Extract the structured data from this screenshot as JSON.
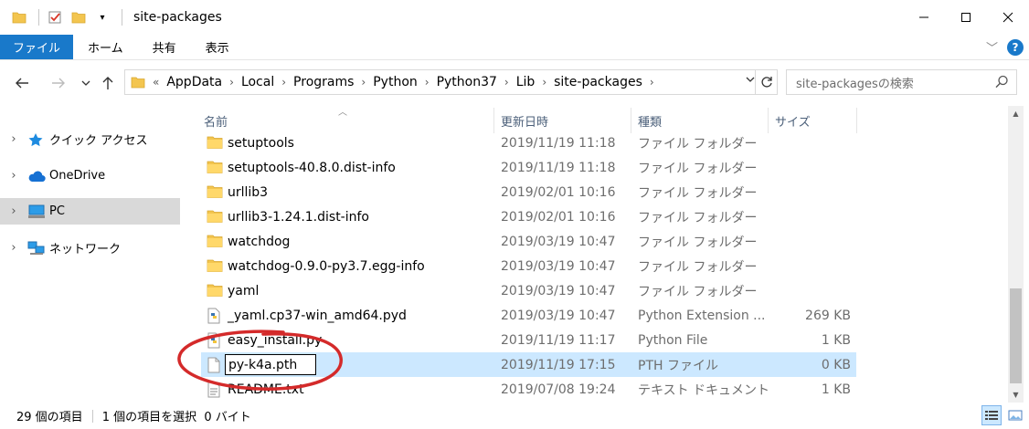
{
  "window": {
    "title": "site-packages"
  },
  "ribbon": {
    "tabs": [
      "ファイル",
      "ホーム",
      "共有",
      "表示"
    ]
  },
  "address": {
    "overflow": "«",
    "crumbs": [
      "AppData",
      "Local",
      "Programs",
      "Python",
      "Python37",
      "Lib",
      "site-packages"
    ],
    "search_placeholder": "site-packagesの検索"
  },
  "navpane": {
    "items": [
      {
        "label": "クイック アクセス",
        "icon": "star-icon",
        "selected": false
      },
      {
        "label": "OneDrive",
        "icon": "cloud-icon",
        "selected": false
      },
      {
        "label": "PC",
        "icon": "computer-icon",
        "selected": true
      },
      {
        "label": "ネットワーク",
        "icon": "network-icon",
        "selected": false
      }
    ]
  },
  "columns": {
    "name": "名前",
    "date": "更新日時",
    "type": "種類",
    "size": "サイズ"
  },
  "files": [
    {
      "name": "setuptools",
      "date": "2019/11/19 11:18",
      "type": "ファイル フォルダー",
      "size": "",
      "icon": "folder-icon"
    },
    {
      "name": "setuptools-40.8.0.dist-info",
      "date": "2019/11/19 11:18",
      "type": "ファイル フォルダー",
      "size": "",
      "icon": "folder-icon"
    },
    {
      "name": "urllib3",
      "date": "2019/02/01 10:16",
      "type": "ファイル フォルダー",
      "size": "",
      "icon": "folder-icon"
    },
    {
      "name": "urllib3-1.24.1.dist-info",
      "date": "2019/02/01 10:16",
      "type": "ファイル フォルダー",
      "size": "",
      "icon": "folder-icon"
    },
    {
      "name": "watchdog",
      "date": "2019/03/19 10:47",
      "type": "ファイル フォルダー",
      "size": "",
      "icon": "folder-icon"
    },
    {
      "name": "watchdog-0.9.0-py3.7.egg-info",
      "date": "2019/03/19 10:47",
      "type": "ファイル フォルダー",
      "size": "",
      "icon": "folder-icon"
    },
    {
      "name": "yaml",
      "date": "2019/03/19 10:47",
      "type": "ファイル フォルダー",
      "size": "",
      "icon": "folder-icon"
    },
    {
      "name": "_yaml.cp37-win_amd64.pyd",
      "date": "2019/03/19 10:47",
      "type": "Python Extension ...",
      "size": "269 KB",
      "icon": "python-file-icon"
    },
    {
      "name": "easy_install.py",
      "date": "2019/11/19 11:17",
      "type": "Python File",
      "size": "1 KB",
      "icon": "python-file-icon"
    },
    {
      "name": "py-k4a.pth",
      "date": "2019/11/19 17:15",
      "type": "PTH ファイル",
      "size": "0 KB",
      "icon": "file-icon",
      "renaming": true
    },
    {
      "name": "README.txt",
      "date": "2019/07/08 19:24",
      "type": "テキスト ドキュメント",
      "size": "1 KB",
      "icon": "text-file-icon"
    }
  ],
  "status": {
    "item_count": "29 個の項目",
    "selection": "1 個の項目を選択  0 バイト"
  },
  "colors": {
    "accent": "#1979ca",
    "selection": "#cce8ff",
    "annotation": "#d42a2a"
  }
}
